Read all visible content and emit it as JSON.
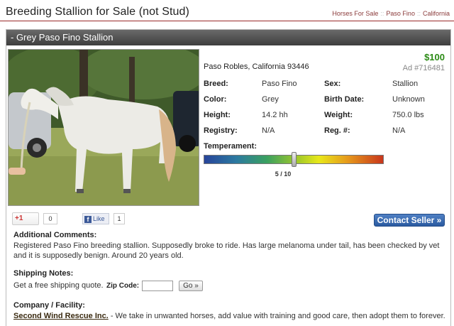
{
  "page": {
    "title": "Breeding Stallion for Sale (not Stud)",
    "breadcrumb": [
      "Horses For Sale",
      "Paso Fino",
      "California"
    ]
  },
  "listing": {
    "header": "- Grey Paso Fino Stallion",
    "price": "$100",
    "ad_number": "Ad #716481",
    "location": "Paso Robles, California 93446",
    "details": [
      {
        "k1": "Breed:",
        "v1": "Paso Fino",
        "k2": "Sex:",
        "v2": "Stallion"
      },
      {
        "k1": "Color:",
        "v1": "Grey",
        "k2": "Birth Date:",
        "v2": "Unknown"
      },
      {
        "k1": "Height:",
        "v1": "14.2 hh",
        "k2": "Weight:",
        "v2": "750.0 lbs"
      },
      {
        "k1": "Registry:",
        "v1": "N/A",
        "k2": "Reg. #:",
        "v2": "N/A"
      }
    ],
    "temperament": {
      "label": "Temperament:",
      "value_text": "5 / 10",
      "level": 0.5
    },
    "colors": {
      "price": "#2a8a14",
      "contact_button": "#2a5aa0"
    }
  },
  "social": {
    "gplus_label": "+1",
    "gplus_count": "0",
    "fb_label": "Like",
    "fb_count": "1"
  },
  "actions": {
    "contact_seller": "Contact Seller »"
  },
  "comments": {
    "heading": "Additional Comments:",
    "text": "Registered Paso Fino breeding stallion. Supposedly broke to ride. Has large melanoma under tail, has been checked by vet and it is supposedly benign. Around 20 years old."
  },
  "shipping": {
    "heading": "Shipping Notes:",
    "text": "Get a free shipping quote.",
    "zip_label": "Zip Code:",
    "zip_value": "",
    "go_label": "Go »"
  },
  "company": {
    "heading": "Company / Facility:",
    "name": "Second Wind Rescue Inc.",
    "description": " - We take in unwanted horses, add value with training and good care, then adopt them to forever."
  }
}
